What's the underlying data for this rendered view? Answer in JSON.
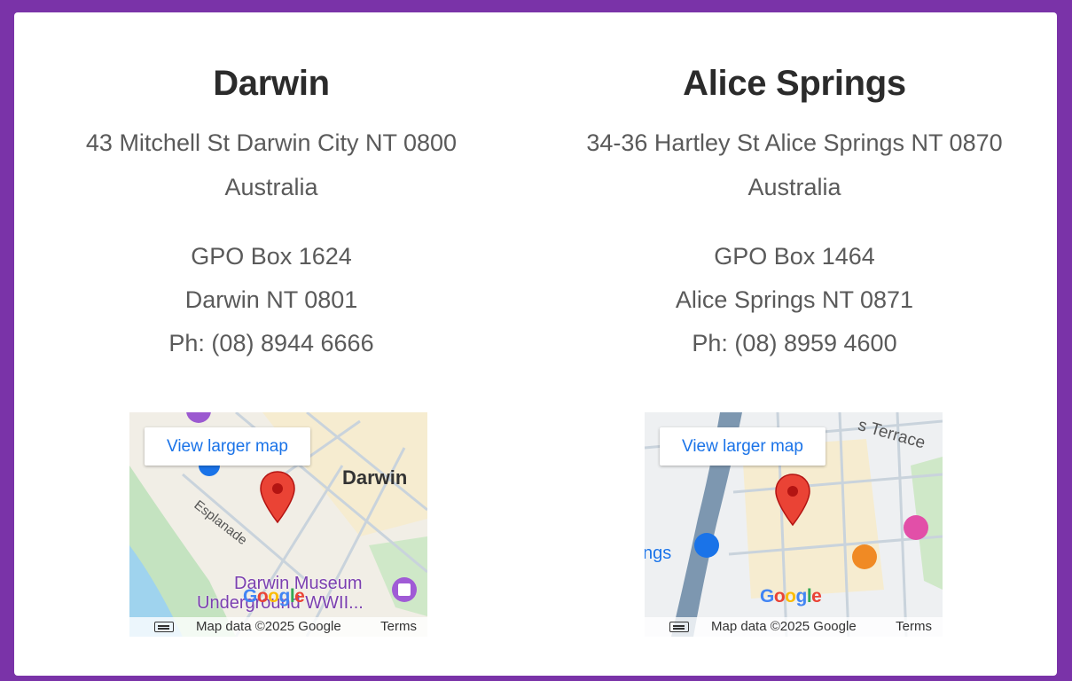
{
  "offices": [
    {
      "city": "Darwin",
      "address_line1": "43 Mitchell St Darwin City NT 0800",
      "address_line2": "Australia",
      "po_box": "GPO Box 1624",
      "postal_city": "Darwin NT 0801",
      "phone": "Ph: (08) 8944 6666",
      "map": {
        "view_larger": "View larger map",
        "city_label": "Darwin",
        "street_label": "Esplanade",
        "poi_label_1": "Darwin Museum",
        "poi_label_2": "Underground WWII...",
        "google": "Google",
        "map_data": "Map data ©2025 Google",
        "terms": "Terms"
      }
    },
    {
      "city": "Alice Springs",
      "address_line1": "34-36 Hartley St Alice Springs NT 0870",
      "address_line2": "Australia",
      "po_box": "GPO Box 1464",
      "postal_city": "Alice Springs NT 0871",
      "phone": "Ph: (08) 8959 4600",
      "map": {
        "view_larger": "View larger map",
        "terrace_label": "s Terrace",
        "edge_label": "ngs",
        "google": "Google",
        "map_data": "Map data ©2025 Google",
        "terms": "Terms"
      }
    }
  ],
  "colors": {
    "border": "#7a33a8",
    "pin": "#ea4335",
    "link": "#1a73e8"
  }
}
